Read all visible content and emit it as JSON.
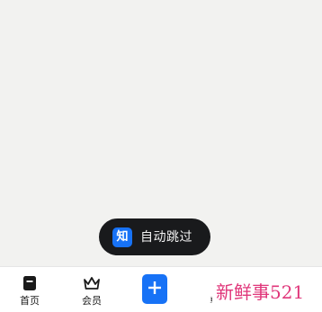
{
  "splash": {
    "logo_text": "知",
    "skip_label": "自动跳过"
  },
  "tab_bar": {
    "tabs": [
      {
        "label": "首页",
        "icon": "home-icon"
      },
      {
        "label": "会员",
        "icon": "crown-icon"
      },
      {
        "label": "",
        "icon": "plus-icon"
      }
    ],
    "partial_tab_label": "፤"
  },
  "watermark": {
    "text": "新鲜事521"
  },
  "colors": {
    "background": "#f2f2f0",
    "accent": "#1772f6",
    "toast_bg": "#191a1c",
    "watermark": "#e0367a"
  }
}
